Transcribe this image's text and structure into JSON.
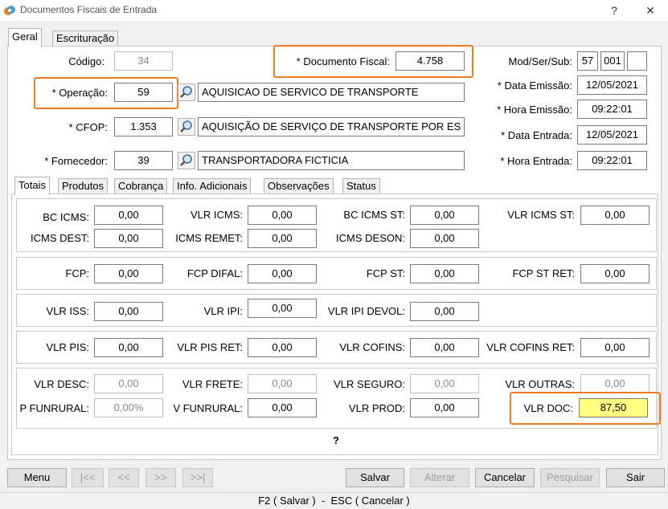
{
  "window": {
    "title": "Documentos Fiscais de Entrada",
    "help": "?",
    "close": "✕"
  },
  "tabs": [
    "Geral",
    "Escrituração"
  ],
  "header": {
    "codigo_label": "Código:",
    "codigo_value": "34",
    "doc_fiscal_label": "* Documento Fiscal:",
    "doc_fiscal_value": "4.758",
    "modsersub_label": "Mod/Ser/Sub:",
    "mod_value": "57",
    "ser_value": "001",
    "sub_value": "",
    "operacao_label": "* Operação:",
    "operacao_value": "59",
    "operacao_desc": "AQUISICAO DE SERVICO DE TRANSPORTE",
    "cfop_label": "* CFOP:",
    "cfop_value": "1.353",
    "cfop_desc": "AQUISIÇÃO DE SERVIÇO DE TRANSPORTE POR ES",
    "fornecedor_label": "* Fornecedor:",
    "fornecedor_value": "39",
    "fornecedor_desc": "TRANSPORTADORA FICTICIA",
    "data_emissao_label": "* Data Emissão:",
    "data_emissao_value": "12/05/2021",
    "hora_emissao_label": "* Hora Emissão:",
    "hora_emissao_value": "09:22:01",
    "data_entrada_label": "* Data Entrada:",
    "data_entrada_value": "12/05/2021",
    "hora_entrada_label": "* Hora Entrada:",
    "hora_entrada_value": "09:22:01"
  },
  "subtabs": [
    "Totais",
    "Produtos",
    "Cobrança",
    "Info. Adicionais",
    "Observações",
    "Status"
  ],
  "totais": {
    "bc_icms_label": "BC ICMS:",
    "bc_icms": "0,00",
    "vlr_icms_label": "VLR ICMS:",
    "vlr_icms": "0,00",
    "bc_icms_st_label": "BC ICMS ST:",
    "bc_icms_st": "0,00",
    "vlr_icms_st_label": "VLR ICMS ST:",
    "vlr_icms_st": "0,00",
    "icms_dest_label": "ICMS DEST:",
    "icms_dest": "0,00",
    "icms_remet_label": "ICMS REMET:",
    "icms_remet": "0,00",
    "icms_deson_label": "ICMS DESON:",
    "icms_deson": "0,00",
    "fcp_label": "FCP:",
    "fcp": "0,00",
    "fcp_difal_label": "FCP DIFAL:",
    "fcp_difal": "0,00",
    "fcp_st_label": "FCP ST:",
    "fcp_st": "0,00",
    "fcp_st_ret_label": "FCP ST RET:",
    "fcp_st_ret": "0,00",
    "vlr_iss_label": "VLR ISS:",
    "vlr_iss": "0,00",
    "vlr_ipi_label": "VLR IPI:",
    "vlr_ipi": "0,00",
    "vlr_ipi_devol_label": "VLR IPI DEVOL:",
    "vlr_ipi_devol": "0,00",
    "vlr_pis_label": "VLR PIS:",
    "vlr_pis": "0,00",
    "vlr_pis_ret_label": "VLR PIS RET:",
    "vlr_pis_ret": "0,00",
    "vlr_cofins_label": "VLR COFINS:",
    "vlr_cofins": "0,00",
    "vlr_cofins_ret_label": "VLR COFINS RET:",
    "vlr_cofins_ret": "0,00",
    "vlr_desc_label": "VLR DESC:",
    "vlr_desc": "0,00",
    "vlr_frete_label": "VLR FRETE:",
    "vlr_frete": "0,00",
    "vlr_seguro_label": "VLR SEGURO:",
    "vlr_seguro": "0,00",
    "vlr_outras_label": "VLR OUTRAS:",
    "vlr_outras": "0,00",
    "p_funrural_label": "P FUNRURAL:",
    "p_funrural": "0,00%",
    "v_funrural_label": "V FUNRURAL:",
    "v_funrural": "0,00",
    "vlr_prod_label": "VLR PROD:",
    "vlr_prod": "0,00",
    "vlr_doc_label": "VLR DOC:",
    "vlr_doc": "87,50",
    "help_mark": "?"
  },
  "buttons": {
    "menu": "Menu",
    "first": "|<<",
    "prev": "<<",
    "next": ">>",
    "last": ">>|",
    "salvar": "Salvar",
    "alterar": "Alterar",
    "cancelar": "Cancelar",
    "pesquisar": "Pesquisar",
    "sair": "Sair"
  },
  "statusbar": "F2 ( Salvar )  -  ESC ( Cancelar )",
  "colors": {
    "highlight": "#f07b20",
    "doc_total_bg": "#ffff80"
  }
}
